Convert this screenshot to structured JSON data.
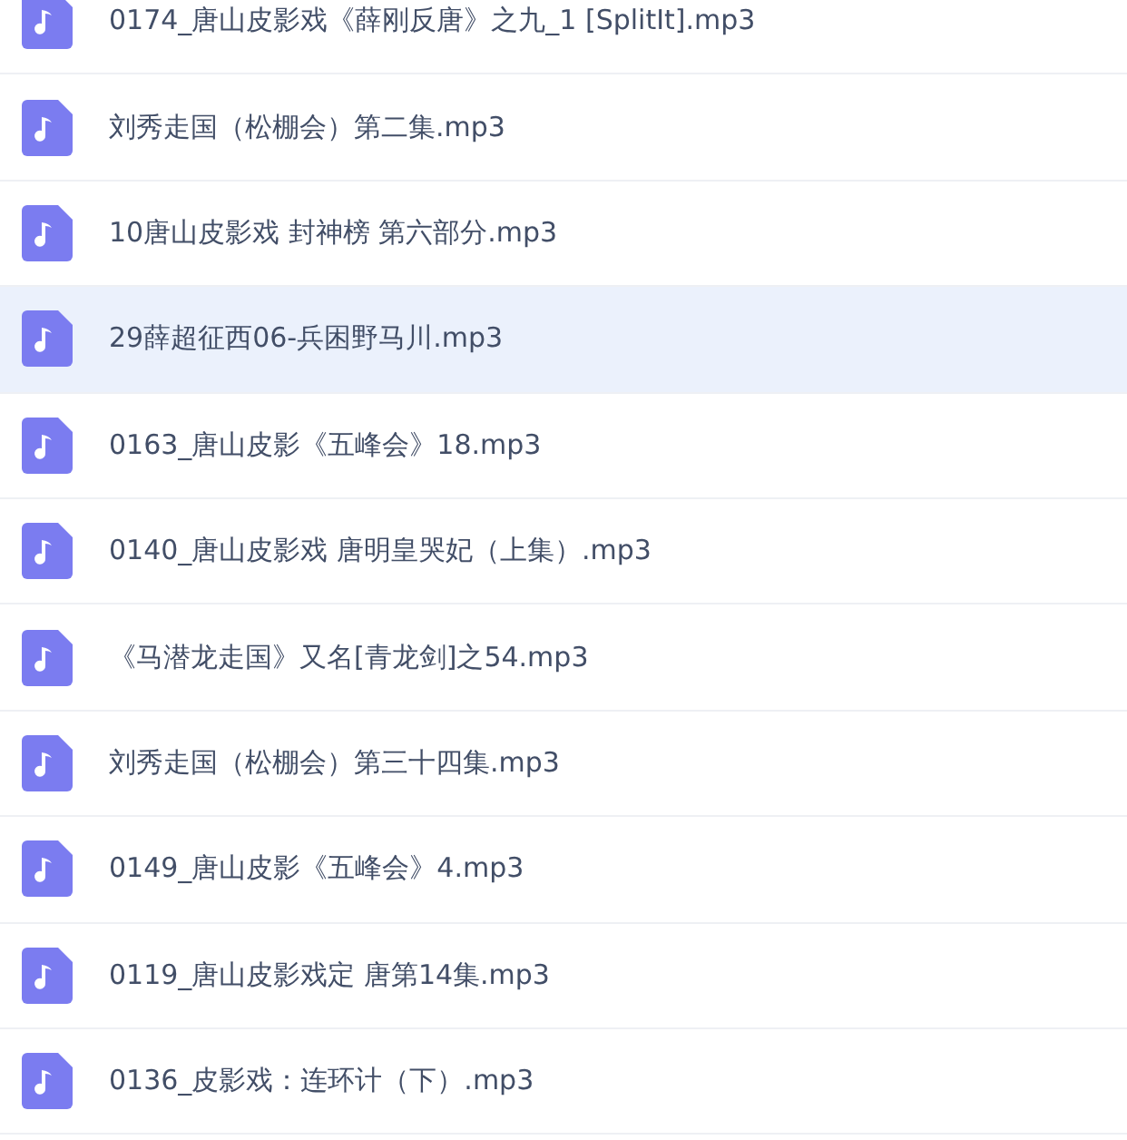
{
  "files": [
    {
      "name": "0174_唐山皮影戏《薛刚反唐》之九_1 [SplitIt].mp3",
      "selected": false
    },
    {
      "name": "刘秀走国（松棚会）第二集.mp3",
      "selected": false
    },
    {
      "name": "10唐山皮影戏 封神榜 第六部分.mp3",
      "selected": false
    },
    {
      "name": "29薛超征西06-兵困野马川.mp3",
      "selected": true
    },
    {
      "name": "0163_唐山皮影《五峰会》18.mp3",
      "selected": false
    },
    {
      "name": "0140_唐山皮影戏 唐明皇哭妃（上集）.mp3",
      "selected": false
    },
    {
      "name": "《马潜龙走国》又名[青龙剑]之54.mp3",
      "selected": false
    },
    {
      "name": "刘秀走国（松棚会）第三十四集.mp3",
      "selected": false
    },
    {
      "name": "0149_唐山皮影《五峰会》4.mp3",
      "selected": false
    },
    {
      "name": "0119_唐山皮影戏定 唐第14集.mp3",
      "selected": false
    },
    {
      "name": "0136_皮影戏：连环计（下）.mp3",
      "selected": false
    }
  ]
}
